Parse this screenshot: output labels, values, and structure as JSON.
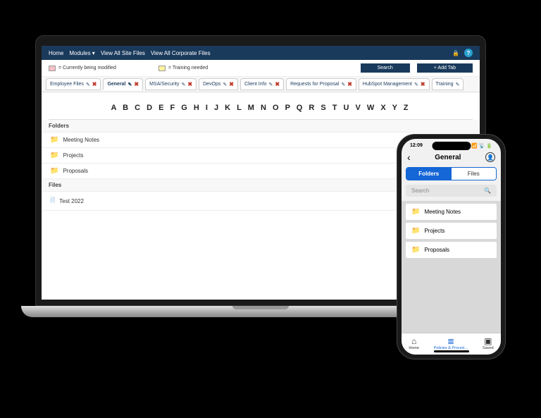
{
  "topbar": {
    "items": [
      "Home",
      "Modules ▾",
      "View All Site Files",
      "View All Corporate Files"
    ]
  },
  "legend": {
    "modified": "= Currently being modified",
    "training": "= Training needed",
    "search_btn": "Search",
    "add_tab_btn": "+ Add Tab"
  },
  "tabs": [
    {
      "label": "Employee Files"
    },
    {
      "label": "General",
      "active": true
    },
    {
      "label": "MSA/Security"
    },
    {
      "label": "DevOps"
    },
    {
      "label": "Client Info"
    },
    {
      "label": "Requests for Proposal"
    },
    {
      "label": "HubSpot Management"
    },
    {
      "label": "Training"
    }
  ],
  "alpha": "A B C D E F G H I J K L M N O P Q R S T U V W X Y Z",
  "sections": {
    "folders_label": "Folders",
    "files_label": "Files",
    "folders": [
      "Meeting Notes",
      "Projects",
      "Proposals"
    ],
    "files": [
      "Test 2022"
    ]
  },
  "phone": {
    "time": "12:09",
    "title": "General",
    "toggle_folders": "Folders",
    "toggle_files": "Files",
    "search_placeholder": "Search",
    "folders": [
      "Meeting Notes",
      "Projects",
      "Proposals"
    ],
    "tabbar": {
      "home": "Home",
      "policies": "Policies & Proced…",
      "saved": "Saved"
    }
  }
}
